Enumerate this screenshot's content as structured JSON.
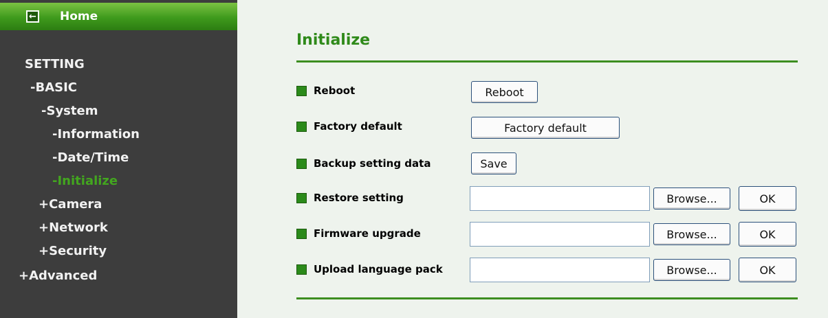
{
  "sidebar": {
    "home_label": "Home",
    "home_icon": "back-arrow-icon",
    "items": [
      {
        "prefix": "",
        "label": "SETTING"
      },
      {
        "prefix": "-",
        "label": "BASIC"
      },
      {
        "prefix": "-",
        "label": "System"
      },
      {
        "prefix": "-",
        "label": "Information"
      },
      {
        "prefix": "-",
        "label": "Date/Time"
      },
      {
        "prefix": "-",
        "label": "Initialize"
      },
      {
        "prefix": "+",
        "label": "Camera"
      },
      {
        "prefix": "+",
        "label": "Network"
      },
      {
        "prefix": "+",
        "label": "Security"
      },
      {
        "prefix": "+",
        "label": "Advanced"
      }
    ],
    "active_item": "Initialize",
    "active_color": "#43a61f"
  },
  "main": {
    "title": "Initialize",
    "rows": [
      {
        "label": "Reboot",
        "button": "Reboot"
      },
      {
        "label": "Factory default",
        "button": "Factory default"
      },
      {
        "label": "Backup setting data",
        "button": "Save"
      },
      {
        "label": "Restore setting",
        "field_value": "",
        "browse": "Browse...",
        "ok": "OK"
      },
      {
        "label": "Firmware upgrade",
        "field_value": "",
        "browse": "Browse...",
        "ok": "OK"
      },
      {
        "label": "Upload language pack",
        "field_value": "",
        "browse": "Browse...",
        "ok": "OK"
      }
    ]
  },
  "colors": {
    "accent": "#2f8a1a",
    "sidebar_bg": "#3d3d3d",
    "main_bg": "#eef3ed"
  }
}
